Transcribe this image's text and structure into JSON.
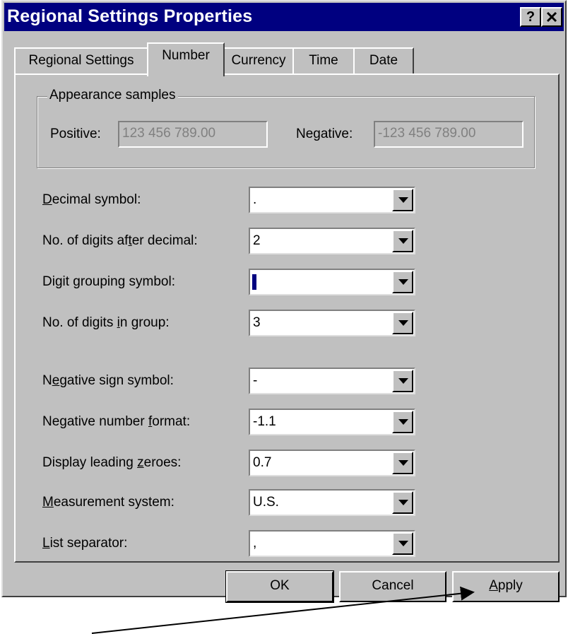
{
  "window": {
    "title": "Regional Settings Properties",
    "help_label": "?",
    "close_label": "✕"
  },
  "tabs": [
    {
      "label": "Regional Settings",
      "active": false
    },
    {
      "label": "Number",
      "active": true
    },
    {
      "label": "Currency",
      "active": false
    },
    {
      "label": "Time",
      "active": false
    },
    {
      "label": "Date",
      "active": false
    }
  ],
  "samples": {
    "group_label": "Appearance samples",
    "positive_label": "Positive:",
    "positive_value": "123 456 789.00",
    "negative_label": "Negative:",
    "negative_value": "-123 456 789.00"
  },
  "fields": [
    {
      "label_pre": "",
      "label_key": "D",
      "label_post": "ecimal symbol:",
      "value": "."
    },
    {
      "label_pre": "No. of digits af",
      "label_key": "t",
      "label_post": "er decimal:",
      "value": "2"
    },
    {
      "label_pre": "Digit ",
      "label_key": "g",
      "label_post": "rouping symbol:",
      "value": ""
    },
    {
      "label_pre": "No. of digits ",
      "label_key": "i",
      "label_post": "n group:",
      "value": "3"
    },
    {
      "label_pre": "N",
      "label_key": "e",
      "label_post": "gative sign symbol:",
      "value": "-"
    },
    {
      "label_pre": "Negative number ",
      "label_key": "f",
      "label_post": "ormat:",
      "value": "-1.1"
    },
    {
      "label_pre": "Display leading ",
      "label_key": "z",
      "label_post": "eroes:",
      "value": "0.7"
    },
    {
      "label_pre": "",
      "label_key": "M",
      "label_post": "easurement system:",
      "value": "U.S."
    },
    {
      "label_pre": "",
      "label_key": "L",
      "label_post": "ist separator:",
      "value": ","
    }
  ],
  "buttons": {
    "ok_label": "OK",
    "cancel_label": "Cancel",
    "apply_key": "A",
    "apply_rest": "pply"
  },
  "colors": {
    "face": "#c0c0c0",
    "titlebar": "#000080",
    "disabled_text": "#808080"
  }
}
